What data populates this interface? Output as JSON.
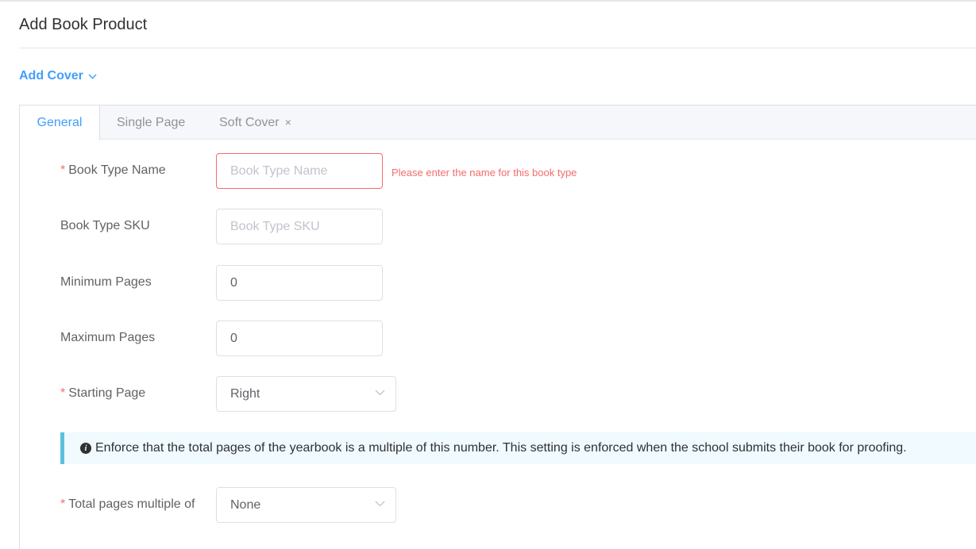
{
  "page": {
    "title": "Add Book Product"
  },
  "add_cover": {
    "label": "Add Cover"
  },
  "tabs": [
    {
      "label": "General",
      "active": true
    },
    {
      "label": "Single Page",
      "active": false
    },
    {
      "label": "Soft Cover",
      "active": false,
      "closable": true,
      "close_symbol": "×"
    }
  ],
  "form": {
    "book_type_name": {
      "label": "Book Type Name",
      "required": "*",
      "placeholder": "Book Type Name",
      "value": "",
      "error": "Please enter the name for this book type"
    },
    "book_type_sku": {
      "label": "Book Type SKU",
      "placeholder": "Book Type SKU",
      "value": ""
    },
    "minimum_pages": {
      "label": "Minimum Pages",
      "value": "0"
    },
    "maximum_pages": {
      "label": "Maximum Pages",
      "value": "0"
    },
    "starting_page": {
      "label": "Starting Page",
      "required": "*",
      "value": "Right"
    },
    "info_alert": {
      "icon": "info-icon",
      "text": "Enforce that the total pages of the yearbook is a multiple of this number. This setting is enforced when the school submits their book for proofing."
    },
    "total_pages_multiple": {
      "label": "Total pages multiple of",
      "required": "*",
      "value": "None"
    }
  },
  "colors": {
    "accent": "#409eff",
    "error": "#f56c6c",
    "alert_border": "#5bc0de",
    "alert_bg": "#f0faff"
  }
}
